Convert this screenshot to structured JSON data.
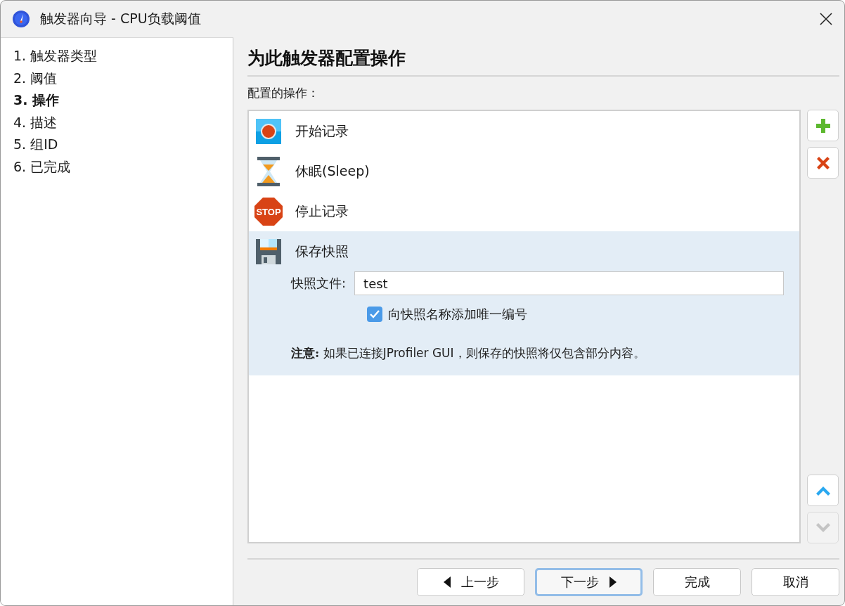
{
  "window": {
    "title": "触发器向导 - CPU负载阈值"
  },
  "steps": [
    {
      "label": "1. 触发器类型",
      "selected": false
    },
    {
      "label": "2. 阈值",
      "selected": false
    },
    {
      "label": "3. 操作",
      "selected": true
    },
    {
      "label": "4. 描述",
      "selected": false
    },
    {
      "label": "5. 组ID",
      "selected": false
    },
    {
      "label": "6. 已完成",
      "selected": false
    }
  ],
  "heading": "为此触发器配置操作",
  "actions_label": "配置的操作：",
  "actions": [
    {
      "kind": "record",
      "label": "开始记录",
      "selected": false
    },
    {
      "kind": "sleep",
      "label": "休眠(Sleep)",
      "selected": false
    },
    {
      "kind": "stop",
      "label": "停止记录",
      "selected": false,
      "sign_text": "STOP"
    },
    {
      "kind": "snapshot",
      "label": "保存快照",
      "selected": true,
      "file_label": "快照文件:",
      "file_value": "test",
      "unique_number": {
        "label": "向快照名称添加唯一编号",
        "checked": true
      },
      "note": "**注意:** 如果已连接JProfiler GUI，则保存的快照将仅包含部分内容。"
    }
  ],
  "side_buttons": [
    {
      "kind": "add",
      "disabled": false
    },
    {
      "kind": "remove",
      "disabled": false
    },
    {
      "kind": "up",
      "disabled": false
    },
    {
      "kind": "down",
      "disabled": true
    }
  ],
  "footer_buttons": [
    {
      "kind": "back",
      "label": "上一步",
      "default": false
    },
    {
      "kind": "next",
      "label": "下一步",
      "default": true
    },
    {
      "kind": "plain",
      "label": "完成",
      "default": false
    },
    {
      "kind": "plain",
      "label": "取消",
      "default": false
    }
  ]
}
